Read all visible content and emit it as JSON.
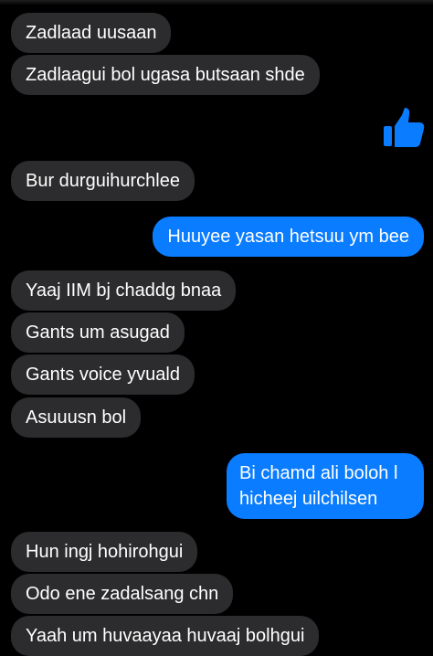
{
  "thread": {
    "messages": [
      {
        "id": "m1",
        "side": "incoming",
        "text": "Zadlaad uusaan"
      },
      {
        "id": "m2",
        "side": "incoming",
        "text": "Zadlaagui bol ugasa butsaan shde"
      },
      {
        "id": "m3",
        "side": "outgoing",
        "type": "like",
        "icon": "thumbs-up-icon"
      },
      {
        "id": "m4",
        "side": "incoming",
        "text": "Bur durguihurchlee"
      },
      {
        "id": "m5",
        "side": "outgoing",
        "text": "Huuyee yasan hetsuu ym bee"
      },
      {
        "id": "m6",
        "side": "incoming",
        "text": "Yaaj IIM bj chaddg bnaa"
      },
      {
        "id": "m7",
        "side": "incoming",
        "text": "Gants um asugad"
      },
      {
        "id": "m8",
        "side": "incoming",
        "text": "Gants voice yvuald"
      },
      {
        "id": "m9",
        "side": "incoming",
        "text": "Asuuusn bol"
      },
      {
        "id": "m10",
        "side": "outgoing",
        "lines": [
          "Bi chamd ali boloh l",
          "hicheej uilchilsen"
        ]
      },
      {
        "id": "m11",
        "side": "incoming",
        "text": "Hun ingj hohirohgui"
      },
      {
        "id": "m12",
        "side": "incoming",
        "text": "Odo ene zadalsang chn"
      },
      {
        "id": "m13",
        "side": "incoming",
        "text": "Yaah um huvaayaa huvaaj bolhgui"
      }
    ]
  },
  "colors": {
    "background": "#000000",
    "incoming_bubble": "#2c2c2e",
    "outgoing_bubble": "#0a7cff",
    "like_icon": "#0a7cff",
    "text": "#ffffff"
  }
}
